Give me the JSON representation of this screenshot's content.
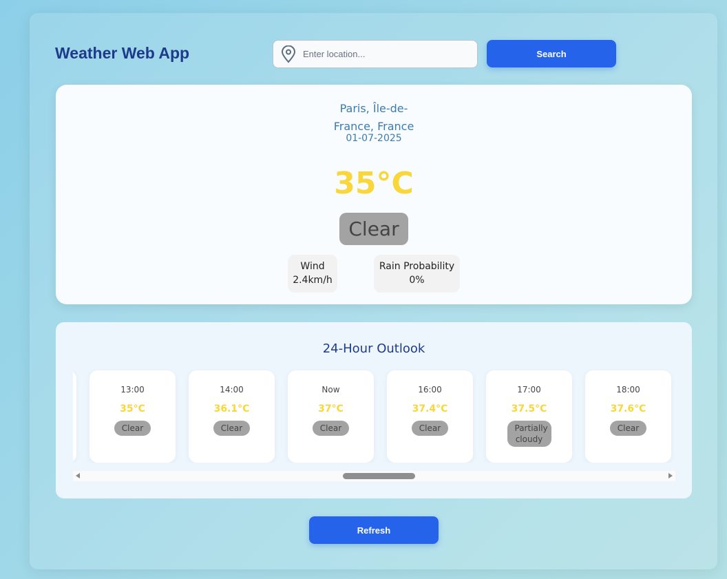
{
  "header": {
    "title": "Weather Web App",
    "search_placeholder": "Enter location...",
    "search_label": "Search"
  },
  "current": {
    "location": "Paris, Île-de-France, France",
    "date": "01-07-2025",
    "temperature": "35°C",
    "condition": "Clear",
    "wind_label": "Wind",
    "wind_value": "2.4km/h",
    "rain_label": "Rain Probability",
    "rain_value": "0%"
  },
  "forecast": {
    "title": "24-Hour Outlook",
    "hours": [
      {
        "time": "13:00",
        "temp": "35°C",
        "condition": "Clear"
      },
      {
        "time": "14:00",
        "temp": "36.1°C",
        "condition": "Clear"
      },
      {
        "time": "Now",
        "temp": "37°C",
        "condition": "Clear"
      },
      {
        "time": "16:00",
        "temp": "37.4°C",
        "condition": "Clear"
      },
      {
        "time": "17:00",
        "temp": "37.5°C",
        "condition": "Partially cloudy"
      },
      {
        "time": "18:00",
        "temp": "37.6°C",
        "condition": "Clear"
      }
    ]
  },
  "refresh_label": "Refresh",
  "colors": {
    "accent": "#2563eb",
    "title": "#1e3a8a",
    "temp": "#f9d63a"
  }
}
